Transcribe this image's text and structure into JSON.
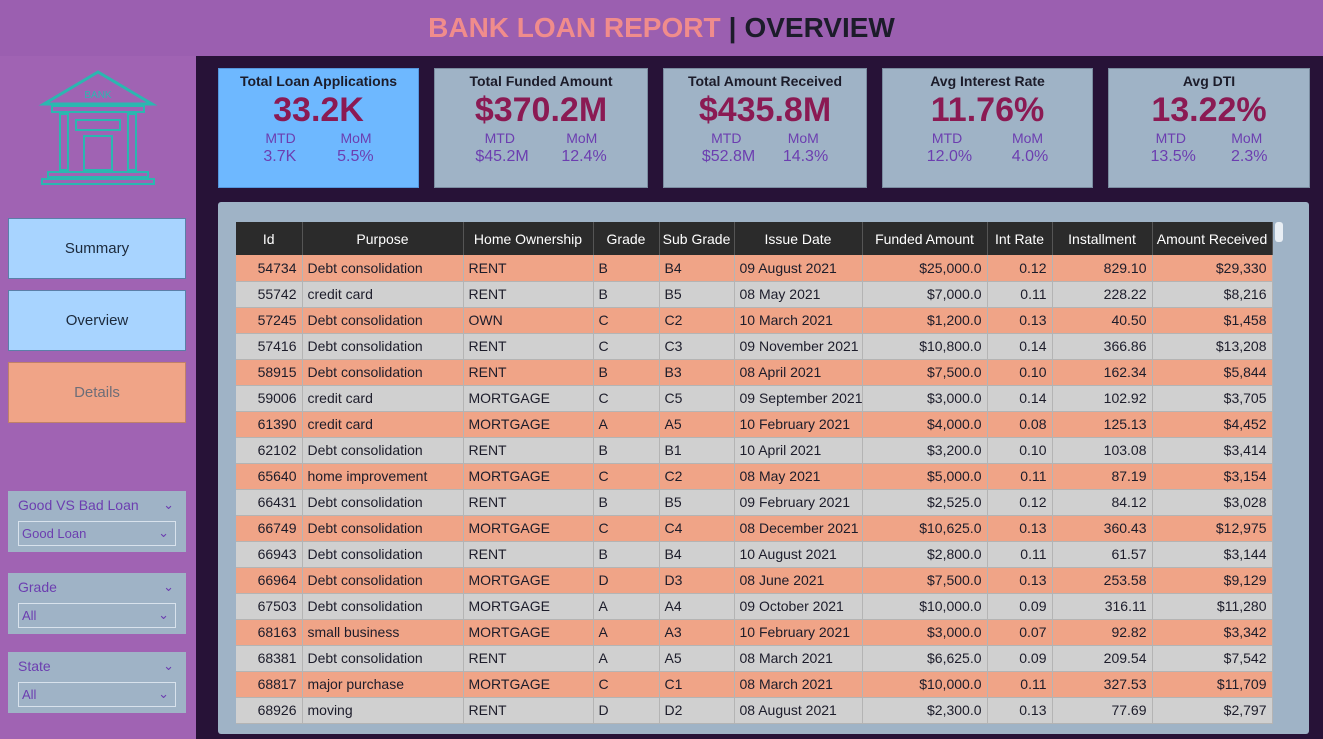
{
  "header": {
    "title_main": "BANK LOAN REPORT",
    "separator": "|",
    "title_sub": "OVERVIEW"
  },
  "sidebar": {
    "nav": {
      "summary": "Summary",
      "overview": "Overview",
      "details": "Details"
    },
    "slicers": {
      "good_bad": {
        "title": "Good VS Bad Loan",
        "value": "Good Loan"
      },
      "grade": {
        "title": "Grade",
        "value": "All"
      },
      "state": {
        "title": "State",
        "value": "All"
      }
    }
  },
  "kpis": {
    "total_loan_applications": {
      "title": "Total Loan Applications",
      "value": "33.2K",
      "mtd_label": "MTD",
      "mom_label": "MoM",
      "mtd": "3.7K",
      "mom": "5.5%"
    },
    "total_funded_amount": {
      "title": "Total Funded Amount",
      "value": "$370.2M",
      "mtd_label": "MTD",
      "mom_label": "MoM",
      "mtd": "$45.2M",
      "mom": "12.4%"
    },
    "total_amount_received": {
      "title": "Total  Amount Received",
      "value": "$435.8M",
      "mtd_label": "MTD",
      "mom_label": "MoM",
      "mtd": "$52.8M",
      "mom": "14.3%"
    },
    "avg_interest_rate": {
      "title": "Avg Interest Rate",
      "value": "11.76%",
      "mtd_label": "MTD",
      "mom_label": "MoM",
      "mtd": "12.0%",
      "mom": "4.0%"
    },
    "avg_dti": {
      "title": "Avg DTI",
      "value": "13.22%",
      "mtd_label": "MTD",
      "mom_label": "MoM",
      "mtd": "13.5%",
      "mom": "2.3%"
    }
  },
  "table": {
    "columns": [
      "Id",
      "Purpose",
      "Home Ownership",
      "Grade",
      "Sub Grade",
      "Issue Date",
      "Funded Amount",
      "Int Rate",
      "Installment",
      "Amount Received"
    ],
    "rows": [
      [
        "54734",
        "Debt consolidation",
        "RENT",
        "B",
        "B4",
        "09 August 2021",
        "$25,000.0",
        "0.12",
        "829.10",
        "$29,330"
      ],
      [
        "55742",
        "credit card",
        "RENT",
        "B",
        "B5",
        "08 May 2021",
        "$7,000.0",
        "0.11",
        "228.22",
        "$8,216"
      ],
      [
        "57245",
        "Debt consolidation",
        "OWN",
        "C",
        "C2",
        "10 March 2021",
        "$1,200.0",
        "0.13",
        "40.50",
        "$1,458"
      ],
      [
        "57416",
        "Debt consolidation",
        "RENT",
        "C",
        "C3",
        "09 November 2021",
        "$10,800.0",
        "0.14",
        "366.86",
        "$13,208"
      ],
      [
        "58915",
        "Debt consolidation",
        "RENT",
        "B",
        "B3",
        "08 April 2021",
        "$7,500.0",
        "0.10",
        "162.34",
        "$5,844"
      ],
      [
        "59006",
        "credit card",
        "MORTGAGE",
        "C",
        "C5",
        "09 September 2021",
        "$3,000.0",
        "0.14",
        "102.92",
        "$3,705"
      ],
      [
        "61390",
        "credit card",
        "MORTGAGE",
        "A",
        "A5",
        "10 February 2021",
        "$4,000.0",
        "0.08",
        "125.13",
        "$4,452"
      ],
      [
        "62102",
        "Debt consolidation",
        "RENT",
        "B",
        "B1",
        "10 April 2021",
        "$3,200.0",
        "0.10",
        "103.08",
        "$3,414"
      ],
      [
        "65640",
        "home improvement",
        "MORTGAGE",
        "C",
        "C2",
        "08 May 2021",
        "$5,000.0",
        "0.11",
        "87.19",
        "$3,154"
      ],
      [
        "66431",
        "Debt consolidation",
        "RENT",
        "B",
        "B5",
        "09 February 2021",
        "$2,525.0",
        "0.12",
        "84.12",
        "$3,028"
      ],
      [
        "66749",
        "Debt consolidation",
        "MORTGAGE",
        "C",
        "C4",
        "08 December 2021",
        "$10,625.0",
        "0.13",
        "360.43",
        "$12,975"
      ],
      [
        "66943",
        "Debt consolidation",
        "RENT",
        "B",
        "B4",
        "10 August 2021",
        "$2,800.0",
        "0.11",
        "61.57",
        "$3,144"
      ],
      [
        "66964",
        "Debt consolidation",
        "MORTGAGE",
        "D",
        "D3",
        "08 June 2021",
        "$7,500.0",
        "0.13",
        "253.58",
        "$9,129"
      ],
      [
        "67503",
        "Debt consolidation",
        "MORTGAGE",
        "A",
        "A4",
        "09 October 2021",
        "$10,000.0",
        "0.09",
        "316.11",
        "$11,280"
      ],
      [
        "68163",
        "small business",
        "MORTGAGE",
        "A",
        "A3",
        "10 February 2021",
        "$3,000.0",
        "0.07",
        "92.82",
        "$3,342"
      ],
      [
        "68381",
        "Debt consolidation",
        "RENT",
        "A",
        "A5",
        "08 March 2021",
        "$6,625.0",
        "0.09",
        "209.54",
        "$7,542"
      ],
      [
        "68817",
        "major purchase",
        "MORTGAGE",
        "C",
        "C1",
        "08 March 2021",
        "$10,000.0",
        "0.11",
        "327.53",
        "$11,709"
      ],
      [
        "68926",
        "moving",
        "RENT",
        "D",
        "D2",
        "08 August 2021",
        "$2,300.0",
        "0.13",
        "77.69",
        "$2,797"
      ]
    ]
  },
  "icons": {
    "logo": "bank-icon",
    "logo_text": "BANK",
    "chevron": "chevron-down-icon"
  },
  "colors": {
    "accent_title": "#f08c8c",
    "kpi_value": "#8b1a53",
    "row_odd": "#f0a487",
    "row_even": "#d0d0d0"
  }
}
